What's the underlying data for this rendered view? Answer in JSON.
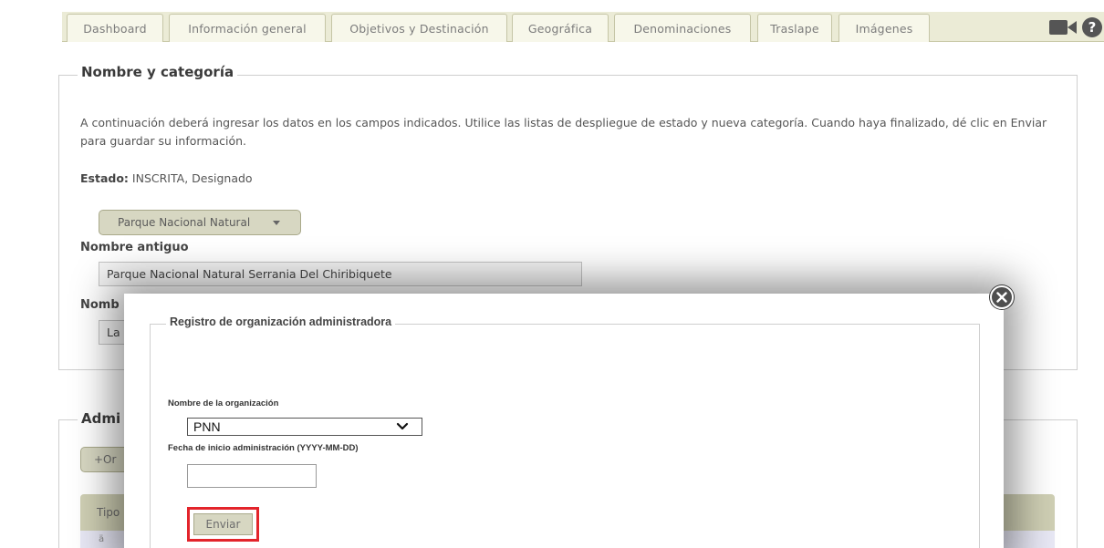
{
  "tabs": [
    {
      "label": "Dashboard"
    },
    {
      "label": "Información general"
    },
    {
      "label": "Objetivos y Destinación"
    },
    {
      "label": "Geográfica"
    },
    {
      "label": "Denominaciones"
    },
    {
      "label": "Traslape"
    },
    {
      "label": "Imágenes"
    }
  ],
  "toolbar_icons": [
    "video-camera-icon",
    "help-icon"
  ],
  "help_glyph": "?",
  "section1": {
    "legend": "Nombre y categoría",
    "intro": "A continuación deberá ingresar los datos en los campos indicados. Utilice las listas de despliegue de estado y nueva categoría. Cuando haya finalizado, dé clic en Enviar para guardar su información.",
    "estado_label": "Estado:",
    "estado_value": "INSCRITA, Designado",
    "category_selected": "Parque Nacional Natural",
    "old_name_label": "Nombre antiguo",
    "old_name_value": "Parque Nacional Natural Serrania Del Chiribiquete",
    "new_name_label_partial": "Nomb",
    "new_name_value_partial": "La"
  },
  "section2": {
    "legend_partial": "Admi",
    "add_button_partial": "+Or",
    "table_header_partial": "Tipo",
    "row_glyph": "ä"
  },
  "modal": {
    "legend": "Registro de organización administradora",
    "org_label": "Nombre de la organización",
    "org_selected": "PNN",
    "date_label": "Fecha de inicio administración (YYYY-MM-DD)",
    "date_value": "",
    "submit_label": "Enviar"
  },
  "colors": {
    "tab_bg": "#f7f7ea",
    "button_bg": "#d7d7c2",
    "highlight_outline": "#e3242b",
    "close_button": "#4f4f4f"
  }
}
